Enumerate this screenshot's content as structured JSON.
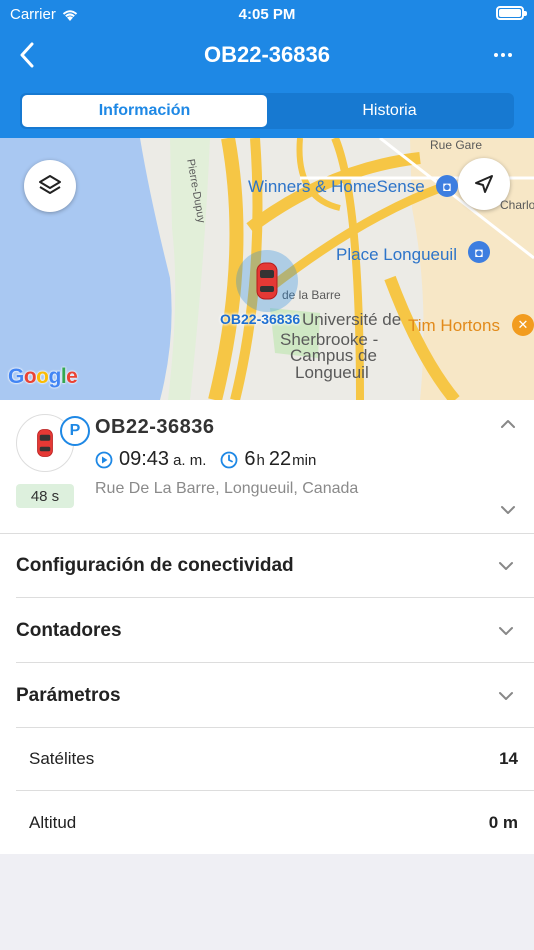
{
  "status_bar": {
    "carrier": "Carrier",
    "time": "4:05 PM"
  },
  "nav": {
    "title": "OB22-36836"
  },
  "tabs": [
    {
      "label": "Información",
      "active": true
    },
    {
      "label": "Historia",
      "active": false
    }
  ],
  "map": {
    "labels": {
      "winners": "Winners & HomeSense",
      "place": "Place Longueuil",
      "tim": "Tim Hortons",
      "univ1": "Université de",
      "univ2": "Sherbrooke -",
      "univ3": "Campus de",
      "univ4": "Longueuil",
      "street_barre": "de la Barre",
      "street_dupuy": "Pierre-Dupuy",
      "street_charlotte": "Charlotte",
      "street_gare": "Rue Gare"
    },
    "vehicle_label": "OB22-36836",
    "attribution": "Google"
  },
  "vehicle": {
    "name": "OB22-36836",
    "status_badge": "P",
    "age": "48 s",
    "time": "09:43",
    "time_suffix": "a. m.",
    "duration_h": "6",
    "duration_h_unit": "h",
    "duration_m": "22",
    "duration_m_unit": "min",
    "address": "Rue De La Barre, Longueuil, Canada"
  },
  "sections": {
    "connectivity": "Configuración de conectividad",
    "counters": "Contadores",
    "parameters": "Parámetros"
  },
  "params": [
    {
      "name": "Satélites",
      "value": "14"
    },
    {
      "name": "Altitud",
      "value": "0 m"
    }
  ],
  "colors": {
    "accent": "#1E88E5",
    "age_badge": "#DDF0DD"
  }
}
